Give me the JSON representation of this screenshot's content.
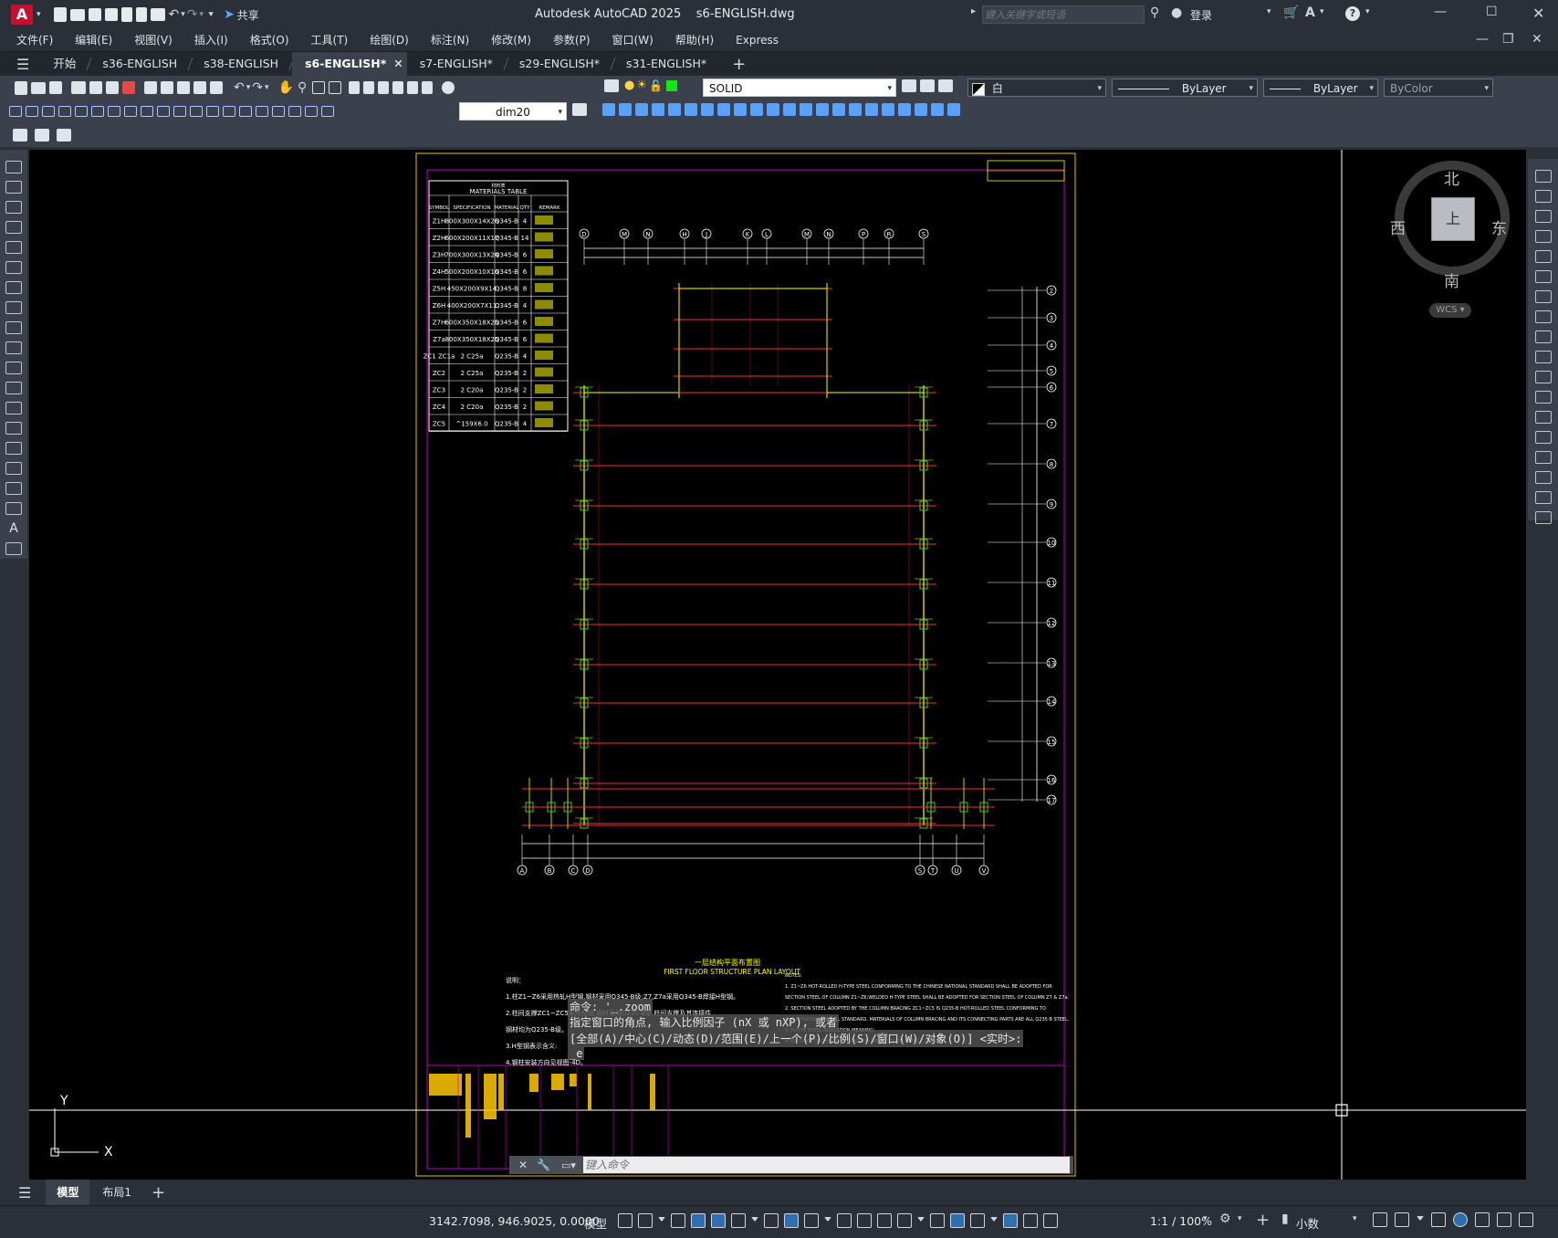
{
  "window": {
    "title": "Autodesk AutoCAD 2025    s6-ENGLISH.dwg",
    "share_label": "共享",
    "search_placeholder": "键入关键字或短语",
    "login_label": "登录",
    "help_label": "?"
  },
  "menu": [
    "文件(F)",
    "编辑(E)",
    "视图(V)",
    "插入(I)",
    "格式(O)",
    "工具(T)",
    "绘图(D)",
    "标注(N)",
    "修改(M)",
    "参数(P)",
    "窗口(W)",
    "帮助(H)",
    "Express"
  ],
  "tabs": [
    {
      "label": "开始",
      "active": false
    },
    {
      "label": "s36-ENGLISH",
      "active": false
    },
    {
      "label": "s38-ENGLISH",
      "active": false
    },
    {
      "label": "s6-ENGLISH*",
      "active": true
    },
    {
      "label": "s7-ENGLISH*",
      "active": false
    },
    {
      "label": "s29-ENGLISH*",
      "active": false
    },
    {
      "label": "s31-ENGLISH*",
      "active": false
    }
  ],
  "layer_toolbar": {
    "layer_name": "SOLID",
    "color_value": "白",
    "linetype_value": "ByLayer",
    "lineweight_value": "ByLayer",
    "plotstyle_value": "ByColor"
  },
  "dim_style": "dim20",
  "viewcube": {
    "north": "北",
    "south": "南",
    "west": "西",
    "east": "东",
    "face": "上",
    "wcs": "WCS"
  },
  "ucs": {
    "x_label": "X",
    "y_label": "Y"
  },
  "drawing": {
    "materials_table_title": "MATERIALS TABLE",
    "materials_table_subtitle": "材料表",
    "table_headers": [
      "SYMBOL",
      "SPECIFICATION",
      "MATERIAL",
      "QTY",
      "REMARK"
    ],
    "table_rows": [
      [
        "Z1H",
        "800X300X14X26",
        "Q345-B",
        "4"
      ],
      [
        "Z2H",
        "600X200X11X17",
        "Q345-B",
        "14"
      ],
      [
        "Z3H",
        "700X300X13X24",
        "Q345-B",
        "6"
      ],
      [
        "Z4H",
        "500X200X10X16",
        "Q345-B",
        "6"
      ],
      [
        "Z5H",
        "450X200X9X14",
        "Q345-B",
        "8"
      ],
      [
        "Z6H",
        "400X200X7X11",
        "Q345-B",
        "4"
      ],
      [
        "Z7H",
        "600X350X18X25",
        "Q345-B",
        "6"
      ],
      [
        "Z7a",
        "800X350X18X25",
        "Q345-B",
        "6"
      ],
      [
        "ZC1 ZC1a",
        "2 C25a",
        "Q235-B",
        "4"
      ],
      [
        "ZC2",
        "2 C25a",
        "Q235-B",
        "2"
      ],
      [
        "ZC3",
        "2 C20a",
        "Q235-B",
        "2"
      ],
      [
        "ZC4",
        "2 C20a",
        "Q235-B",
        "2"
      ],
      [
        "ZC5",
        "^159X6.0",
        "Q235-B",
        "4"
      ]
    ],
    "top_axes": [
      "D",
      "M",
      "N",
      "H",
      "J",
      "K",
      "L",
      "M",
      "N",
      "P",
      "R",
      "S"
    ],
    "bottom_axes": [
      "A",
      "B",
      "C",
      "D",
      "S",
      "T",
      "U",
      "V"
    ],
    "right_axes": [
      "2",
      "3",
      "4",
      "5",
      "6",
      "7",
      "8",
      "9",
      "10",
      "11",
      "12",
      "13",
      "14",
      "15",
      "16",
      "17"
    ],
    "plan_title_cn": "一层结构平面布置图",
    "plan_title_en": "FIRST FLOOR STRUCTURE PLAN LAYOUT",
    "notes_left": [
      "说明：",
      "1.柱Z1~Z6采用热轧H型钢,钢材采用Q345-B级;Z7,Z7a采用Q345-B焊接H型钢。",
      "2.柱间支撑ZC1~ZC5采用型钢,钢材采用Q235-B级,柱间支撑及其连接件",
      "  钢材均为Q235-B级。",
      "3.H型钢表示含义:",
      "4.钢柱安装方向见视图-4D。"
    ],
    "notes_right": [
      "NOTES:",
      "1. Z1~Z6 HOT-ROLLED H-TYPE STEEL CONFORMING TO THE CHINESE NATIONAL STANDARD SHALL BE ADOPTED FOR",
      "   SECTION STEEL OF COLUMN Z1~Z6;WELDED H-TYPE STEEL SHALL BE ADOPTED FOR SECTION STEEL OF COLUMN Z7 & Z7a.",
      "2. SECTION STEEL ADOPTED BY THE COLUMN BRACING ZC1~ZC5 IS Q235-B HOT-ROLLED STEEL CONFORMING TO",
      "   THE CHINESE NATIONAL STANDARD. MATERIALS OF COLUMN BRACING AND ITS CONNECTING PARTS ARE ALL Q235-B STEEL.",
      "3. H-TYPE STEEL INDICATION MEANING:",
      "4.SEE S-40 FOR THE CONSTRUCTION DIRECTION OF STEEL COLUMN."
    ]
  },
  "command": {
    "history": [
      "命令: '_.zoom",
      "指定窗口的角点, 输入比例因子 (nX 或 nXP), 或者",
      "[全部(A)/中心(C)/动态(D)/范围(E)/上一个(P)/比例(S)/窗口(W)/对象(O)] <实时>:",
      "_e"
    ],
    "placeholder": "键入命令"
  },
  "layout_tabs": [
    "模型",
    "布局1"
  ],
  "status": {
    "coordinates": "3142.7098, 946.9025, 0.0000",
    "model": "模型",
    "scale": "1:1 / 100%",
    "units": "小数"
  }
}
